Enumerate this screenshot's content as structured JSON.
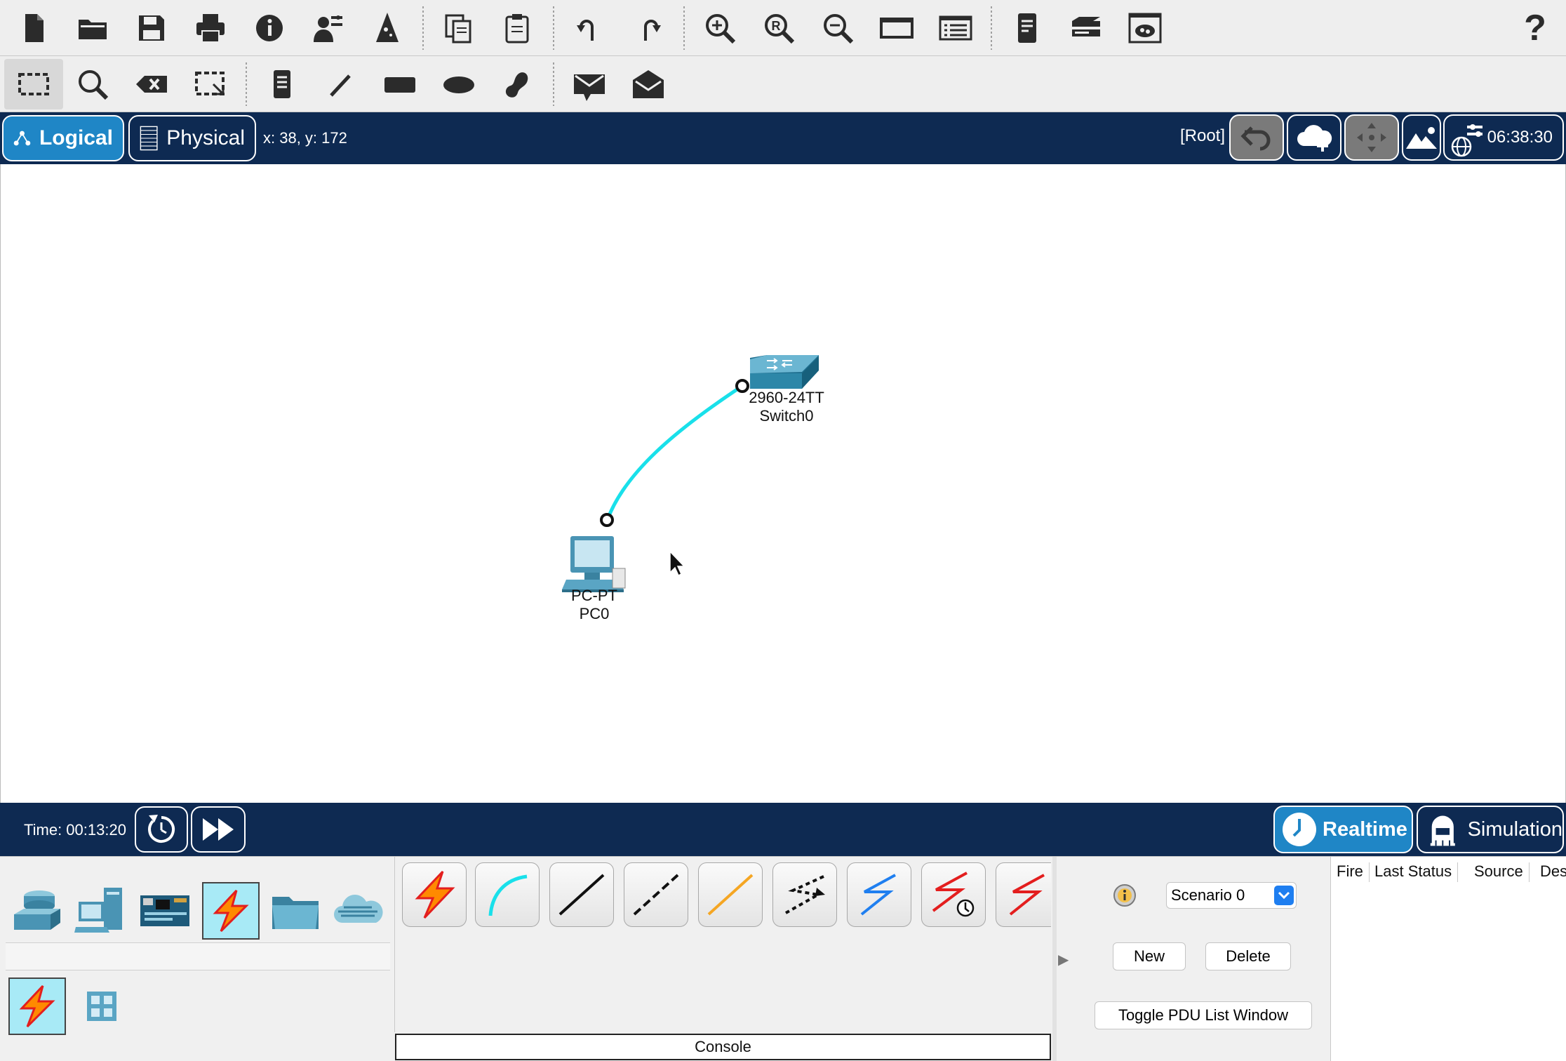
{
  "toolbar_main": {
    "buttons": [
      "new-file",
      "open-folder",
      "save",
      "print",
      "info",
      "activity-wizard",
      "custom-device",
      "copy",
      "paste",
      "undo",
      "redo",
      "zoom-in",
      "zoom-reset",
      "zoom-out",
      "drawing-palette",
      "custom-devices-dialog",
      "pdu-list",
      "device-template",
      "cloud-image"
    ],
    "help": "?"
  },
  "toolbar_tools": {
    "buttons": [
      "select",
      "inspect",
      "delete",
      "resize-shape",
      "place-note",
      "draw-line",
      "draw-rectangle",
      "draw-ellipse",
      "draw-freeform",
      "add-simple-pdu",
      "add-complex-pdu"
    ]
  },
  "workspace": {
    "logical_label": "Logical",
    "physical_label": "Physical",
    "coords": "x: 38, y: 172",
    "root": "[Root]",
    "clock": "06:38:30"
  },
  "topology": {
    "switch": {
      "model": "2960-24TT",
      "name": "Switch0"
    },
    "pc": {
      "model": "PC-PT",
      "name": "PC0"
    },
    "link_color": "#19e0ea"
  },
  "timebar": {
    "time": "Time: 00:13:20",
    "realtime": "Realtime",
    "simulation": "Simulation"
  },
  "device_panel": {
    "categories": [
      "network-devices",
      "end-devices",
      "components",
      "connections",
      "miscellaneous",
      "multiuser-connection"
    ],
    "selected_category": "connections",
    "subcategories": [
      "connections",
      "structured-cabling"
    ],
    "cables": [
      "automatic",
      "console",
      "copper-straight-through",
      "copper-cross-over",
      "fiber",
      "phone",
      "coaxial",
      "serial-dce",
      "serial-dte"
    ],
    "console_label": "Console"
  },
  "scenario": {
    "selected": "Scenario 0",
    "new_label": "New",
    "delete_label": "Delete",
    "toggle_label": "Toggle PDU List Window"
  },
  "pdu_columns": [
    "Fire",
    "Last Status",
    "Source",
    "Des"
  ],
  "colors": {
    "navy": "#0e2a52",
    "accent": "#1f86c6",
    "selected_cat": "#a8eaf6"
  }
}
